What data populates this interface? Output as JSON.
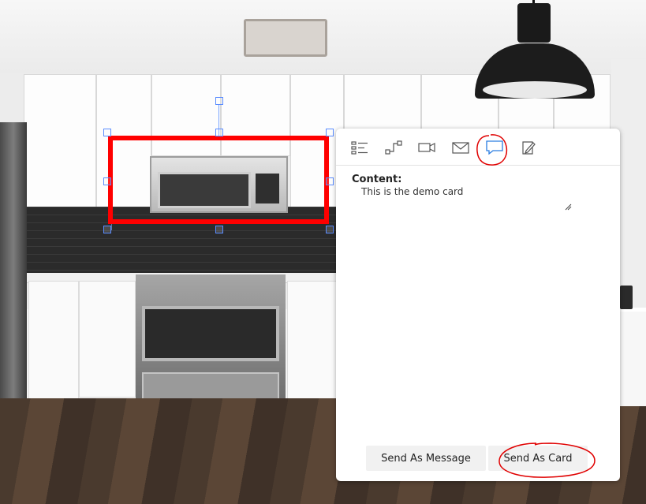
{
  "toolbar": {
    "items": [
      {
        "icon": "list-icon",
        "active": false
      },
      {
        "icon": "connector-icon",
        "active": false
      },
      {
        "icon": "video-icon",
        "active": false
      },
      {
        "icon": "mail-icon",
        "active": false
      },
      {
        "icon": "chat-message-icon",
        "active": true
      },
      {
        "icon": "edit-note-icon",
        "active": false
      }
    ]
  },
  "card": {
    "content_label": "Content:",
    "content_value": "This is the demo card"
  },
  "actions": {
    "send_as_message": "Send As Message",
    "send_as_card": "Send As Card"
  },
  "colors": {
    "selection": "#ff0000",
    "active_icon": "#2a7de1",
    "annotation": "#e00000"
  }
}
